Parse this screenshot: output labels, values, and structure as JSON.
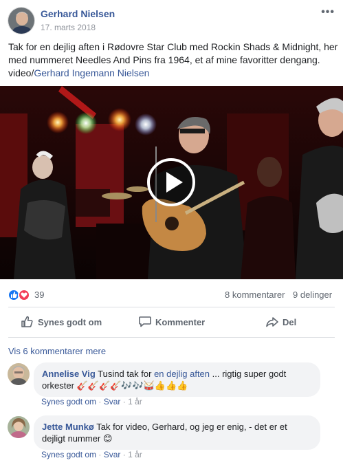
{
  "post": {
    "author": "Gerhard Nielsen",
    "date": "17. marts 2018",
    "more": "•••",
    "text_main": "Tak for en dejlig aften i Rødovre Star Club med Rockin Shads & Midnight, her med nummeret Needles And Pins fra 1964, et af mine favoritter dengang. video/",
    "text_tag": "Gerhard Ingemann Nielsen"
  },
  "stats": {
    "reactions": "39",
    "comments": "8 kommentarer",
    "shares": "9 delinger"
  },
  "actions": {
    "like": "Synes godt om",
    "comment": "Kommenter",
    "share": "Del"
  },
  "view_more": "Vis 6 kommentarer mere",
  "comments": [
    {
      "name": "Annelise Vig",
      "text_before": " Tusind tak for ",
      "highlight": "en dejlig aften",
      "text_after": " ... rigtig super godt orkester 🎸🎸🎸🎸🎶🎶🥁👍👍👍",
      "like": "Synes godt om",
      "reply": "Svar",
      "time": "1 år"
    },
    {
      "name": "Jette Munkø",
      "text": " Tak for video, Gerhard, og jeg er enig, - det er et dejligt nummer 😊",
      "like": "Synes godt om",
      "reply": "Svar",
      "time": "1 år"
    }
  ],
  "colors": {
    "link_blue": "#385898",
    "like_blue": "#1877f2",
    "love_red": "#f33e58",
    "meta_gray": "#90949c",
    "bubble_bg": "#f2f3f5"
  },
  "icons": {
    "post_menu": "more-horizontal-icon",
    "like_action": "thumbs-up-icon",
    "comment_action": "speech-bubble-icon",
    "share_action": "share-arrow-icon",
    "video_play": "play-icon"
  }
}
